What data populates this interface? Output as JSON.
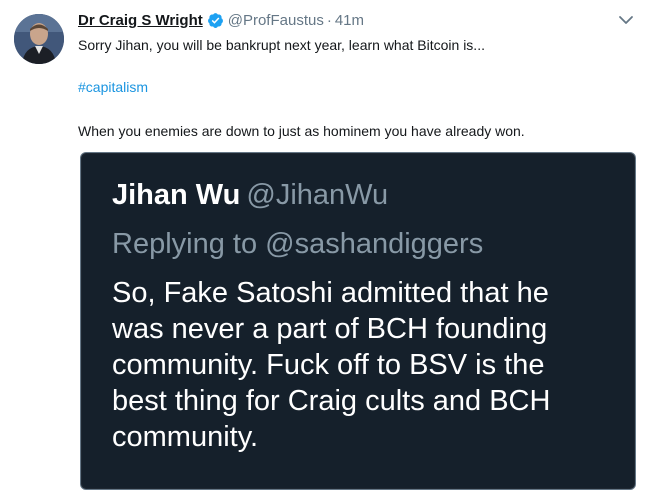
{
  "tweet": {
    "display_name": "Dr Craig S Wright",
    "handle": "@ProfFaustus",
    "separator": "·",
    "time": "41m",
    "line1": "Sorry Jihan, you will be bankrupt next year, learn what Bitcoin is...",
    "hashtag": "#capitalism",
    "line3": "When you enemies are down to just as hominem you have already won."
  },
  "quote": {
    "name": "Jihan Wu",
    "handle": "@JihanWu",
    "replying": "Replying to @sashandiggers",
    "body_lines": [
      "So, Fake Satoshi admitted that he",
      "was never a part of BCH founding",
      "community. Fuck off to BSV is the",
      "best thing for Craig cults and BCH",
      "community."
    ]
  },
  "icons": {
    "verified": "verified-badge-icon",
    "caret": "chevron-down-icon"
  },
  "colors": {
    "link_blue": "#1b95e0",
    "muted": "#657786",
    "quote_bg": "#15202b",
    "quote_muted": "#8899a6"
  }
}
